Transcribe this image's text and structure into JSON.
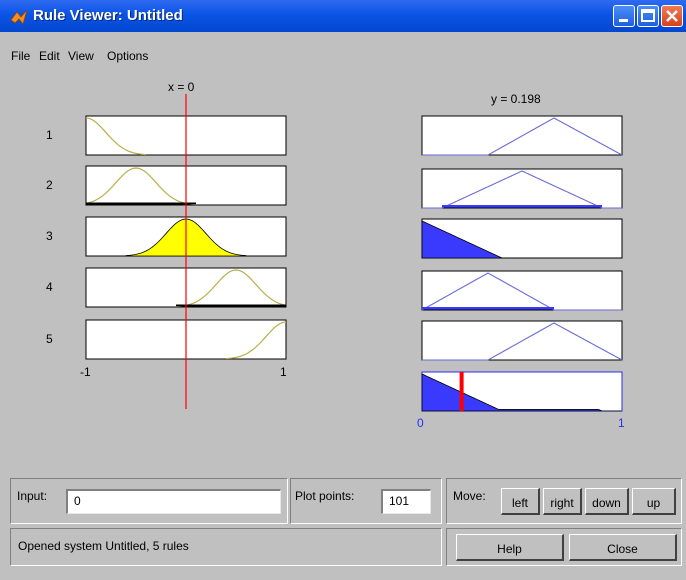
{
  "window": {
    "title": "Rule Viewer: Untitled"
  },
  "menu": [
    "File",
    "Edit",
    "View",
    "Options"
  ],
  "plot": {
    "input_header": "x = 0",
    "output_header": "y = 0.198",
    "rule_numbers": [
      "1",
      "2",
      "3",
      "4",
      "5"
    ],
    "input_axis": {
      "min_label": "-1",
      "max_label": "1"
    },
    "output_axis": {
      "min_label": "0",
      "max_label": "1"
    },
    "input_value": 0,
    "output_value": 0.198,
    "colors": {
      "input_fill": "#ffff00",
      "output_fill": "#3a3aff",
      "mf_line": "#b8b04a",
      "out_line": "#6a6ad8",
      "indicator": "#ff0000"
    }
  },
  "controls": {
    "input_label": "Input:",
    "input_value": "0",
    "plot_points_label": "Plot points:",
    "plot_points_value": "101",
    "move_label": "Move:",
    "move_buttons": [
      "left",
      "right",
      "down",
      "up"
    ],
    "help_label": "Help",
    "close_label": "Close"
  },
  "status": {
    "text": "Opened system Untitled, 5 rules"
  }
}
